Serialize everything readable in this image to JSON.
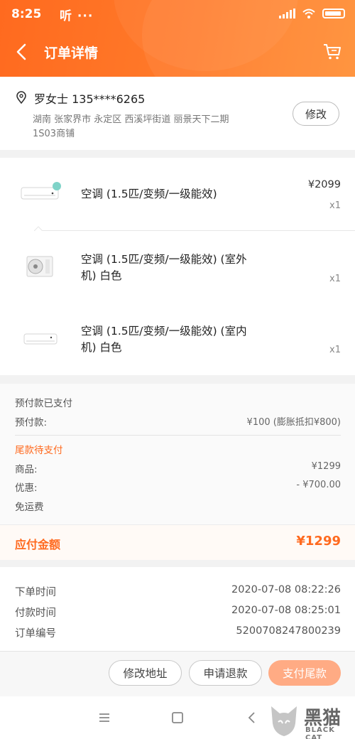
{
  "status": {
    "time": "8:25",
    "extra": "听 ···"
  },
  "header": {
    "title": "订单详情"
  },
  "address": {
    "name_phone": "罗女士 135****6265",
    "line1": "湖南 张家界市 永定区 西溪坪街道 丽景天下二期",
    "line2": "1S03商铺",
    "edit_label": "修改"
  },
  "items": [
    {
      "name": "空调 (1.5匹/变频/一级能效)",
      "price": "¥2099",
      "qty": "x1"
    },
    {
      "name_line1": "空调 (1.5匹/变频/一级能效) (室外",
      "name_line2": "机) 白色",
      "qty": "x1"
    },
    {
      "name_line1": "空调 (1.5匹/变频/一级能效) (室内",
      "name_line2": "机) 白色",
      "qty": "x1"
    }
  ],
  "payment": {
    "deposit_status": "预付款已支付",
    "deposit_label": "预付款:",
    "deposit_value": "¥100 (膨胀抵扣¥800)",
    "balance_status": "尾款待支付",
    "goods_label": "商品:",
    "goods_value": "¥1299",
    "discount_label": "优惠:",
    "discount_value": "- ¥700.00",
    "shipping_label": "免运费",
    "due_label": "应付金额",
    "due_value": "¥1299"
  },
  "order_info": [
    {
      "label": "下单时间",
      "value": "2020-07-08 08:22:26"
    },
    {
      "label": "付款时间",
      "value": "2020-07-08 08:25:01"
    },
    {
      "label": "订单编号",
      "value": "5200708247800239"
    }
  ],
  "actions": {
    "change_address": "修改地址",
    "refund": "申请退款",
    "pay_balance": "支付尾款"
  },
  "watermark": {
    "main": "黑猫",
    "sub": "BLACK CAT"
  },
  "colors": {
    "accent": "#ff6a1f",
    "pay_button": "#ffab84"
  }
}
